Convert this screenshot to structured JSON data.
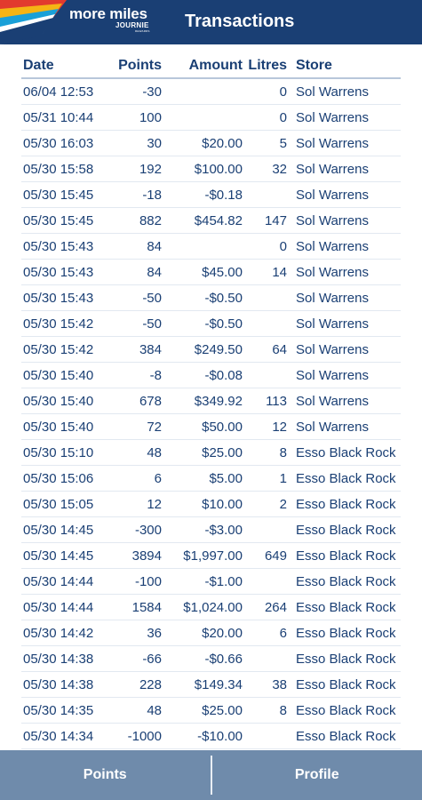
{
  "header": {
    "logo_text": "more miles",
    "logo_sub": "JOURNIE",
    "logo_tiny": "REWARDS",
    "title": "Transactions"
  },
  "table": {
    "columns": [
      "Date",
      "Points",
      "Amount",
      "Litres",
      "Store"
    ],
    "rows": [
      [
        "06/04 12:53",
        "-30",
        "",
        "0",
        "Sol Warrens"
      ],
      [
        "05/31 10:44",
        "100",
        "",
        "0",
        "Sol Warrens"
      ],
      [
        "05/30 16:03",
        "30",
        "$20.00",
        "5",
        "Sol Warrens"
      ],
      [
        "05/30 15:58",
        "192",
        "$100.00",
        "32",
        "Sol Warrens"
      ],
      [
        "05/30 15:45",
        "-18",
        "-$0.18",
        "",
        "Sol Warrens"
      ],
      [
        "05/30 15:45",
        "882",
        "$454.82",
        "147",
        "Sol Warrens"
      ],
      [
        "05/30 15:43",
        "84",
        "",
        "0",
        "Sol Warrens"
      ],
      [
        "05/30 15:43",
        "84",
        "$45.00",
        "14",
        "Sol Warrens"
      ],
      [
        "05/30 15:43",
        "-50",
        "-$0.50",
        "",
        "Sol Warrens"
      ],
      [
        "05/30 15:42",
        "-50",
        "-$0.50",
        "",
        "Sol Warrens"
      ],
      [
        "05/30 15:42",
        "384",
        "$249.50",
        "64",
        "Sol Warrens"
      ],
      [
        "05/30 15:40",
        "-8",
        "-$0.08",
        "",
        "Sol Warrens"
      ],
      [
        "05/30 15:40",
        "678",
        "$349.92",
        "113",
        "Sol Warrens"
      ],
      [
        "05/30 15:40",
        "72",
        "$50.00",
        "12",
        "Sol Warrens"
      ],
      [
        "05/30 15:10",
        "48",
        "$25.00",
        "8",
        "Esso Black Rock"
      ],
      [
        "05/30 15:06",
        "6",
        "$5.00",
        "1",
        "Esso Black Rock"
      ],
      [
        "05/30 15:05",
        "12",
        "$10.00",
        "2",
        "Esso Black Rock"
      ],
      [
        "05/30 14:45",
        "-300",
        "-$3.00",
        "",
        "Esso Black Rock"
      ],
      [
        "05/30 14:45",
        "3894",
        "$1,997.00",
        "649",
        "Esso Black Rock"
      ],
      [
        "05/30 14:44",
        "-100",
        "-$1.00",
        "",
        "Esso Black Rock"
      ],
      [
        "05/30 14:44",
        "1584",
        "$1,024.00",
        "264",
        "Esso Black Rock"
      ],
      [
        "05/30 14:42",
        "36",
        "$20.00",
        "6",
        "Esso Black Rock"
      ],
      [
        "05/30 14:38",
        "-66",
        "-$0.66",
        "",
        "Esso Black Rock"
      ],
      [
        "05/30 14:38",
        "228",
        "$149.34",
        "38",
        "Esso Black Rock"
      ],
      [
        "05/30 14:35",
        "48",
        "$25.00",
        "8",
        "Esso Black Rock"
      ],
      [
        "05/30 14:34",
        "-1000",
        "-$10.00",
        "",
        "Esso Black Rock"
      ]
    ]
  },
  "footer": {
    "points_label": "Points",
    "profile_label": "Profile"
  },
  "colors": {
    "header_bg": "#1a3f74",
    "text": "#1a3f74",
    "footer_bg": "#6f8bab"
  }
}
